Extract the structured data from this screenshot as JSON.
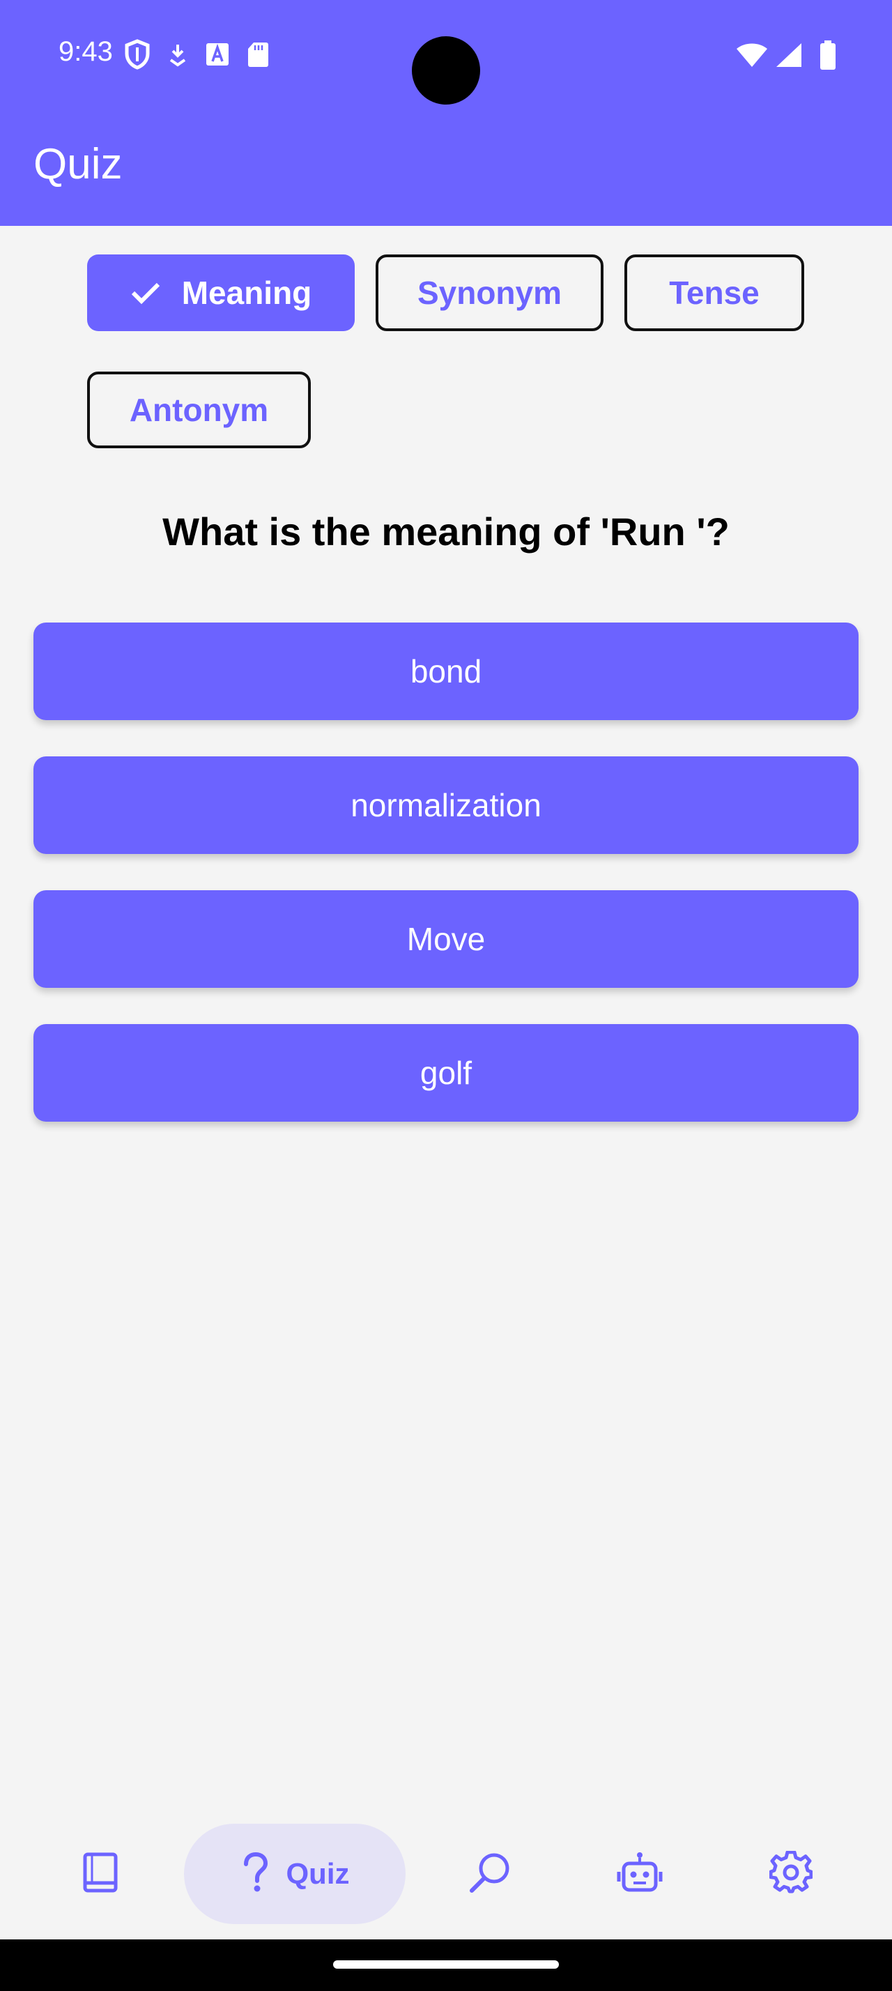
{
  "status_bar": {
    "time": "9:43",
    "left_icons": [
      "shield-icon",
      "download-icon",
      "font-icon",
      "sd-card-icon"
    ],
    "right_icons": [
      "wifi-icon",
      "signal-icon",
      "battery-icon"
    ]
  },
  "app_bar": {
    "title": "Quiz"
  },
  "filter_chips": [
    {
      "label": "Meaning",
      "selected": true
    },
    {
      "label": "Synonym",
      "selected": false
    },
    {
      "label": "Tense",
      "selected": false
    },
    {
      "label": "Antonym",
      "selected": false
    }
  ],
  "question": "What is the meaning of 'Run '?",
  "options": [
    "bond",
    "normalization",
    "Move",
    "golf"
  ],
  "bottom_nav": {
    "items": [
      {
        "icon": "book-icon",
        "label": ""
      },
      {
        "icon": "question-icon",
        "label": "Quiz",
        "active": true
      },
      {
        "icon": "search-icon",
        "label": ""
      },
      {
        "icon": "robot-icon",
        "label": ""
      },
      {
        "icon": "gear-icon",
        "label": ""
      }
    ]
  },
  "colors": {
    "primary": "#6C63FF",
    "background": "#F4F4F4",
    "nav_active_bg": "#E5E3F6"
  }
}
